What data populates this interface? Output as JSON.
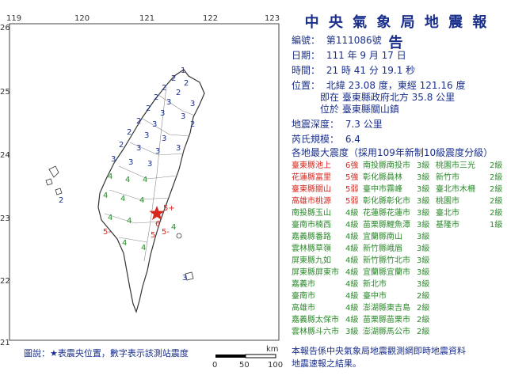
{
  "report": {
    "title": "中 央 氣 象 局 地 震 報 告",
    "number_label": "編號：",
    "number": "第111086號",
    "date_label": "日期：",
    "date": "111 年 9 月 17 日",
    "time_label": "時間：",
    "time": "21 時 41 分 19.1 秒",
    "location_label": "位置：",
    "location_coords": "北緯 23.08 度，東經 121.16 度",
    "location_rel": "即在 臺東縣政府北方 35.8 公里",
    "location_in": "位於 臺東縣關山鎮",
    "depth_label": "地震深度：",
    "depth": "7.3 公里",
    "magnitude_label": "芮氏規模：",
    "magnitude": "6.4",
    "intensity_header": "各地最大震度（採用109年新制10級震度分級）",
    "footer_line1": "本報告係中央氣象局地震觀測網即時地震資料",
    "footer_line2": "地震速報之結果。"
  },
  "intensity_table": [
    [
      {
        "place": "臺東縣池上",
        "lvl": "6強",
        "color": "#d7261e"
      },
      {
        "place": "南投縣南投市",
        "lvl": "3級",
        "color": "#2b8a2b"
      },
      {
        "place": "桃園市三光",
        "lvl": "2級",
        "color": "#2b8a2b"
      }
    ],
    [
      {
        "place": "花蓮縣富里",
        "lvl": "5強",
        "color": "#d7261e"
      },
      {
        "place": "彰化縣員林",
        "lvl": "3級",
        "color": "#2b8a2b"
      },
      {
        "place": "新竹市",
        "lvl": "2級",
        "color": "#2b8a2b"
      }
    ],
    [
      {
        "place": "臺東縣關山",
        "lvl": "5弱",
        "color": "#d7261e"
      },
      {
        "place": "臺中市霧峰",
        "lvl": "3級",
        "color": "#2b8a2b"
      },
      {
        "place": "臺北市木柵",
        "lvl": "2級",
        "color": "#2b8a2b"
      }
    ],
    [
      {
        "place": "高雄市桃源",
        "lvl": "5弱",
        "color": "#d7261e"
      },
      {
        "place": "彰化縣彰化市",
        "lvl": "3級",
        "color": "#2b8a2b"
      },
      {
        "place": "桃園市",
        "lvl": "2級",
        "color": "#2b8a2b"
      }
    ],
    [
      {
        "place": "南投縣玉山",
        "lvl": "4級",
        "color": "#2b8a2b"
      },
      {
        "place": "花蓮縣花蓮市",
        "lvl": "3級",
        "color": "#2b8a2b"
      },
      {
        "place": "臺北市",
        "lvl": "2級",
        "color": "#2b8a2b"
      }
    ],
    [
      {
        "place": "臺南市楠西",
        "lvl": "4級",
        "color": "#2b8a2b"
      },
      {
        "place": "苗栗縣鯉魚潭",
        "lvl": "3級",
        "color": "#2b8a2b"
      },
      {
        "place": "基隆市",
        "lvl": "1級",
        "color": "#2b8a2b"
      }
    ],
    [
      {
        "place": "嘉義縣番路",
        "lvl": "4級",
        "color": "#2b8a2b"
      },
      {
        "place": "宜蘭縣南山",
        "lvl": "3級",
        "color": "#2b8a2b"
      },
      {
        "place": "",
        "lvl": "",
        "color": "#2b8a2b"
      }
    ],
    [
      {
        "place": "雲林縣草嶺",
        "lvl": "4級",
        "color": "#2b8a2b"
      },
      {
        "place": "新竹縣峨眉",
        "lvl": "3級",
        "color": "#2b8a2b"
      },
      {
        "place": "",
        "lvl": "",
        "color": "#2b8a2b"
      }
    ],
    [
      {
        "place": "屏東縣九如",
        "lvl": "4級",
        "color": "#2b8a2b"
      },
      {
        "place": "新竹縣竹北市",
        "lvl": "3級",
        "color": "#2b8a2b"
      },
      {
        "place": "",
        "lvl": "",
        "color": "#2b8a2b"
      }
    ],
    [
      {
        "place": "屏東縣屏東市",
        "lvl": "4級",
        "color": "#2b8a2b"
      },
      {
        "place": "宜蘭縣宜蘭市",
        "lvl": "3級",
        "color": "#2b8a2b"
      },
      {
        "place": "",
        "lvl": "",
        "color": "#2b8a2b"
      }
    ],
    [
      {
        "place": "嘉義市",
        "lvl": "4級",
        "color": "#2b8a2b"
      },
      {
        "place": "新北市",
        "lvl": "3級",
        "color": "#2b8a2b"
      },
      {
        "place": "",
        "lvl": "",
        "color": "#2b8a2b"
      }
    ],
    [
      {
        "place": "臺南市",
        "lvl": "4級",
        "color": "#2b8a2b"
      },
      {
        "place": "臺中市",
        "lvl": "2級",
        "color": "#2b8a2b"
      },
      {
        "place": "",
        "lvl": "",
        "color": "#2b8a2b"
      }
    ],
    [
      {
        "place": "高雄市",
        "lvl": "4級",
        "color": "#2b8a2b"
      },
      {
        "place": "澎湖縣東吉島",
        "lvl": "2級",
        "color": "#2b8a2b"
      },
      {
        "place": "",
        "lvl": "",
        "color": "#2b8a2b"
      }
    ],
    [
      {
        "place": "嘉義縣太保市",
        "lvl": "4級",
        "color": "#2b8a2b"
      },
      {
        "place": "苗栗縣苗栗市",
        "lvl": "2級",
        "color": "#2b8a2b"
      },
      {
        "place": "",
        "lvl": "",
        "color": "#2b8a2b"
      }
    ],
    [
      {
        "place": "雲林縣斗六市",
        "lvl": "3級",
        "color": "#2b8a2b"
      },
      {
        "place": "澎湖縣馬公市",
        "lvl": "2級",
        "color": "#2b8a2b"
      },
      {
        "place": "",
        "lvl": "",
        "color": "#2b8a2b"
      }
    ]
  ],
  "map": {
    "lon_ticks": [
      "119",
      "120",
      "121",
      "122",
      "123"
    ],
    "lat_ticks": [
      "26",
      "25",
      "24",
      "23",
      "22",
      "21"
    ],
    "legend_text": "圖說：★表震央位置，數字表示該測站震度",
    "scale_unit": "km",
    "scale_ticks": [
      "0",
      "50",
      "100"
    ],
    "accent": "#d7261e",
    "station_color": "#1a2f8c"
  }
}
